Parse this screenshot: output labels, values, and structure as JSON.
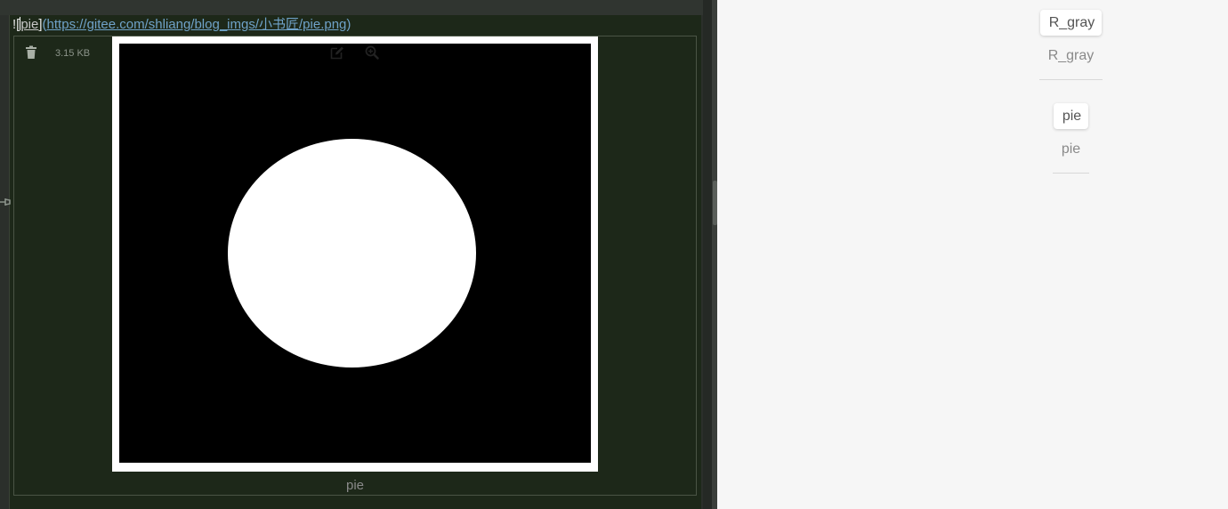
{
  "editor": {
    "markdown": {
      "excl": "!",
      "open_bracket": "[",
      "alt": "pie",
      "close_bracket": "]",
      "open_paren": "(",
      "url": "https://gitee.com/shliang/blog_imgs/小书匠/pie.png",
      "close_paren": ")"
    },
    "image_block": {
      "size": "3.15 KB",
      "caption": "pie",
      "icons": {
        "delete": "trash-icon",
        "edit": "edit-icon",
        "zoom": "zoom-in-icon",
        "pin": "pin-icon"
      }
    }
  },
  "preview": {
    "images": [
      {
        "alt": "R_gray",
        "label": "R_gray"
      },
      {
        "alt": "pie",
        "label": "pie"
      }
    ]
  },
  "colors": {
    "editor_bg": "#1d2819",
    "link": "#6fa2c8",
    "preview_bg": "#f6f6f6"
  }
}
